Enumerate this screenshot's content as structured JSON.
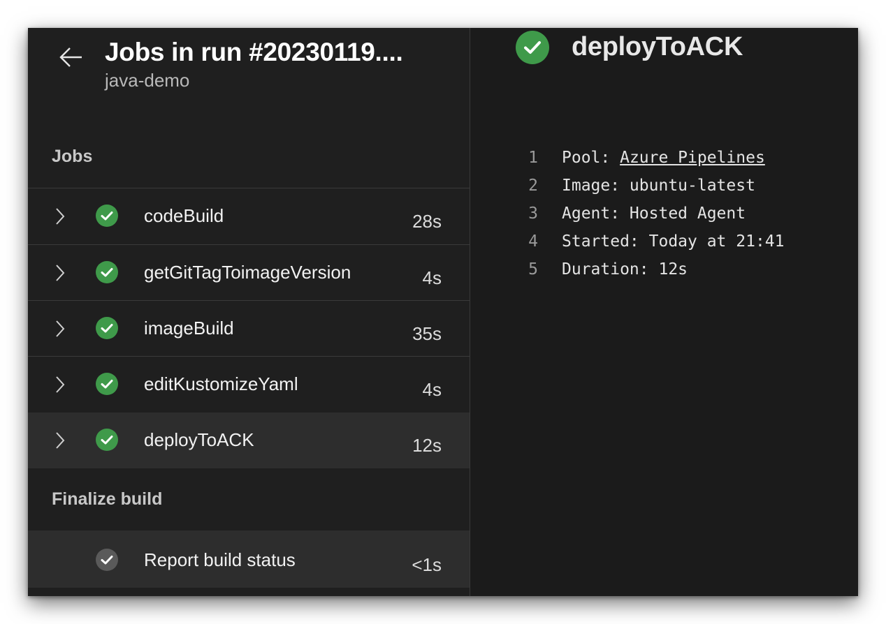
{
  "header": {
    "title": "Jobs in run #20230119....",
    "subtitle": "java-demo"
  },
  "sections": {
    "jobs_label": "Jobs",
    "finalize_label": "Finalize build"
  },
  "jobs": [
    {
      "name": "codeBuild",
      "duration": "28s"
    },
    {
      "name": "getGitTagToimageVersion",
      "duration": "4s"
    },
    {
      "name": "imageBuild",
      "duration": "35s"
    },
    {
      "name": "editKustomizeYaml",
      "duration": "4s"
    },
    {
      "name": "deployToACK",
      "duration": "12s"
    }
  ],
  "finalize": [
    {
      "name": "Report build status",
      "duration": "<1s"
    }
  ],
  "detail": {
    "title": "deployToACK",
    "log": [
      {
        "num": "1",
        "label": "Pool: ",
        "link": "Azure Pipelines"
      },
      {
        "num": "2",
        "text": "Image: ubuntu-latest"
      },
      {
        "num": "3",
        "text": "Agent: Hosted Agent"
      },
      {
        "num": "4",
        "text": "Started: Today at 21:41"
      },
      {
        "num": "5",
        "text": "Duration: 12s"
      }
    ]
  },
  "colors": {
    "success": "#3f9a4a",
    "neutral": "#5a5a5a",
    "background": "#1b1b1b",
    "selected_row": "#2d2d2d"
  },
  "icons": {
    "back": "arrow-left-icon",
    "expand": "chevron-right-icon",
    "success": "check-circle-icon"
  }
}
